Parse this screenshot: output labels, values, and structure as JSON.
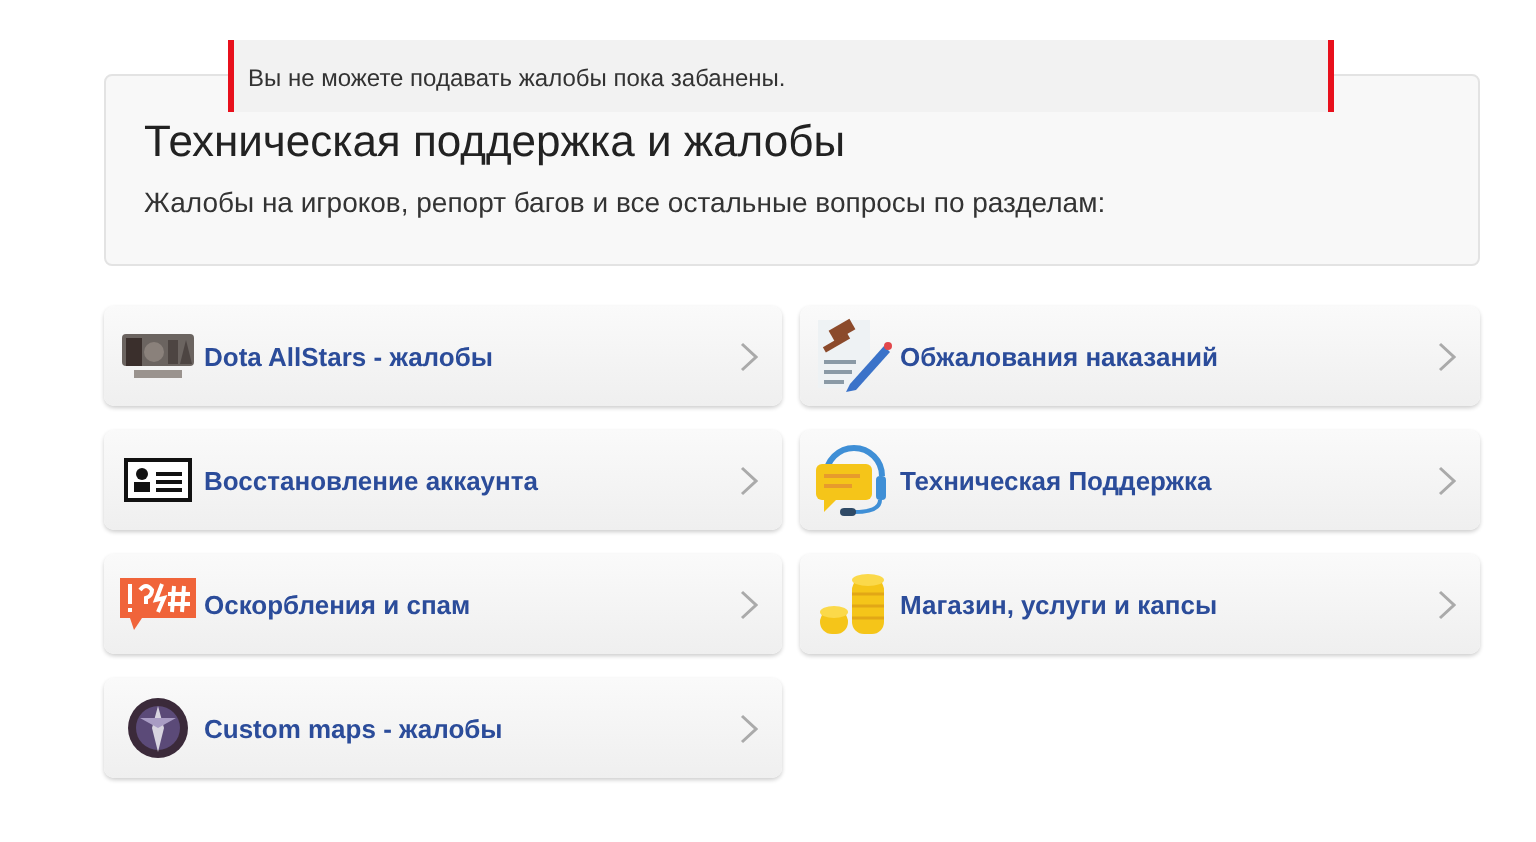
{
  "alert": {
    "text": "Вы не можете подавать жалобы пока забанены."
  },
  "header": {
    "title": "Техническая поддержка и жалобы",
    "subtitle": "Жалобы на игроков, репорт багов и все остальные вопросы по разделам:"
  },
  "sections": [
    {
      "label": "Dota AllStars - жалобы",
      "kind": "logo"
    },
    {
      "label": "Обжалования наказаний",
      "kind": "gavel"
    },
    {
      "label": "Восстановление аккаунта",
      "kind": "card"
    },
    {
      "label": "Техническая Поддержка",
      "kind": "headset"
    },
    {
      "label": "Оскорбления и спам",
      "kind": "chat"
    },
    {
      "label": "Магазин, услуги и капсы",
      "kind": "coins"
    },
    {
      "label": "Custom maps - жалобы",
      "kind": "emblem"
    }
  ]
}
